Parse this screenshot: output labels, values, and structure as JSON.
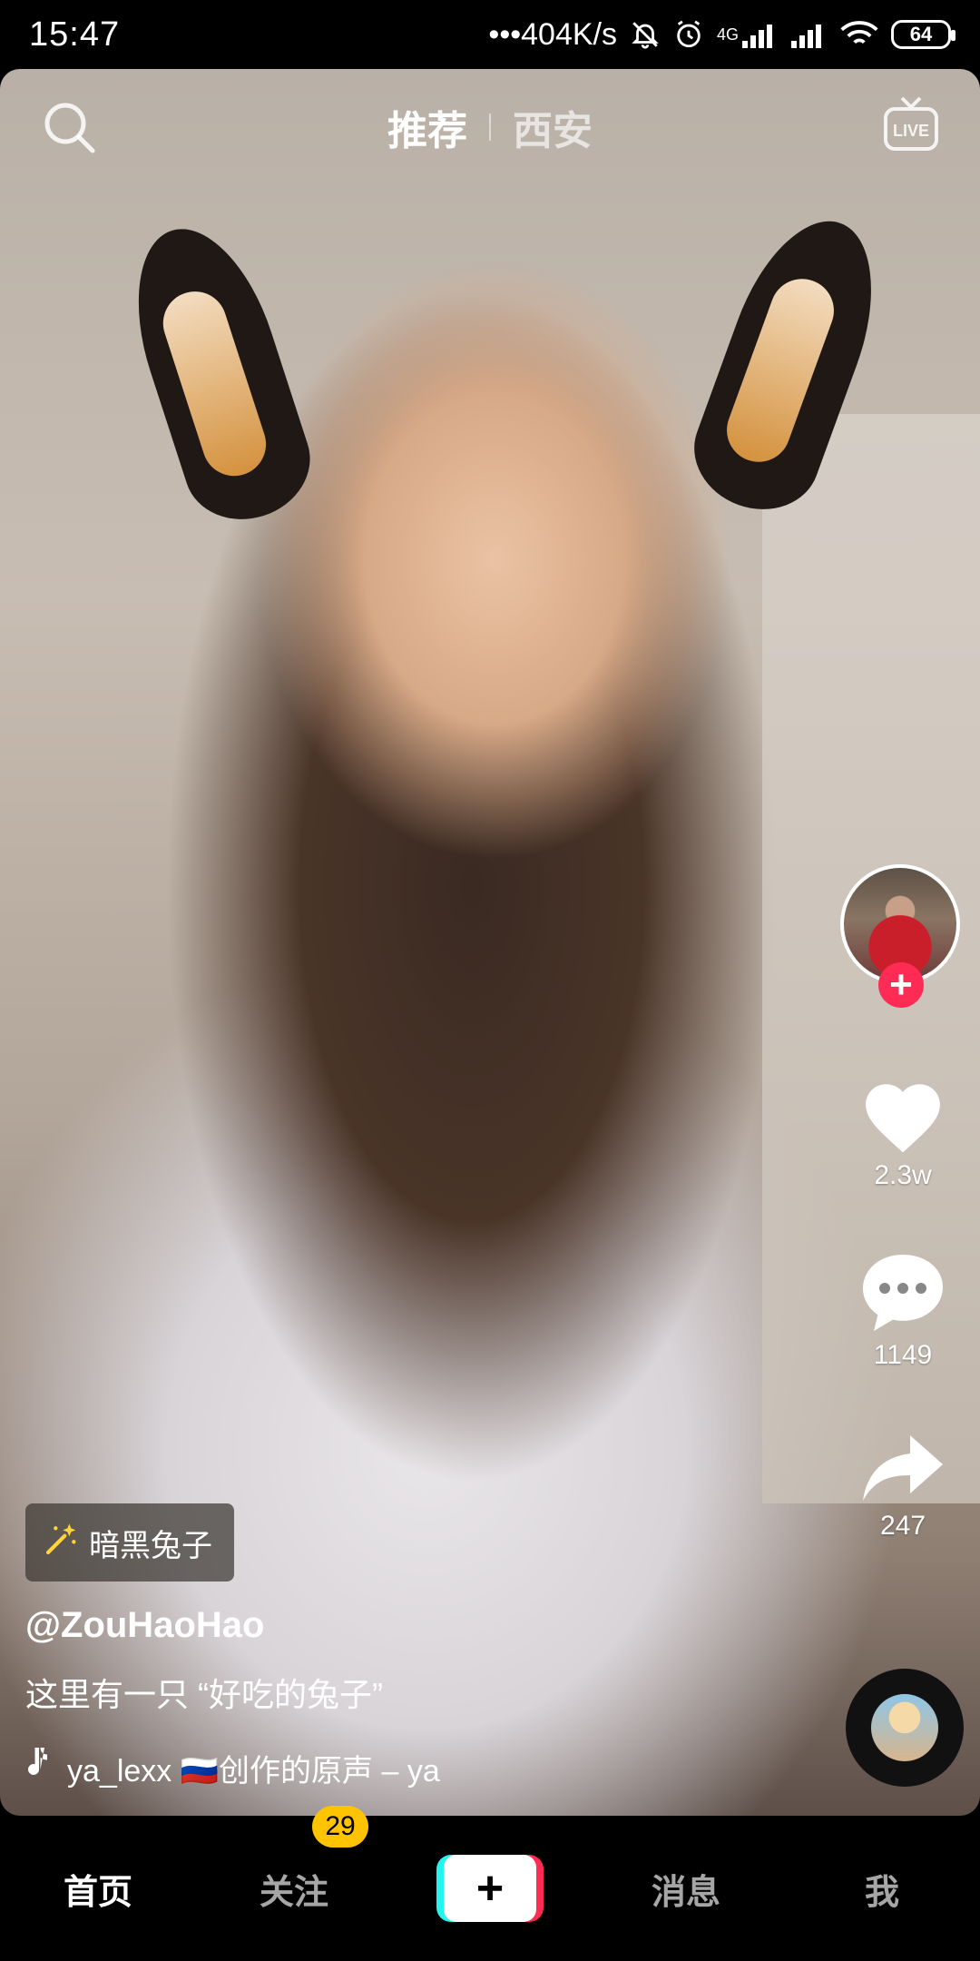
{
  "status_bar": {
    "time": "15:47",
    "network_speed": "•••404K/s",
    "network_type": "4G",
    "battery": "64"
  },
  "top_nav": {
    "tabs": [
      {
        "label": "推荐",
        "active": true
      },
      {
        "label": "西安",
        "active": false
      }
    ],
    "search_icon": "search-icon",
    "live_icon": "live-icon",
    "live_label": "LIVE"
  },
  "creator": {
    "avatar_icon": "avatar",
    "follow_label": "+"
  },
  "actions": {
    "like_count": "2.3w",
    "comment_count": "1149",
    "share_count": "247"
  },
  "info": {
    "effect_label": "暗黑兔子",
    "username": "@ZouHaoHao",
    "caption": "这里有一只 “好吃的兔子”",
    "music_text": "ya_lexx 🇷🇺创作的原声 – ya"
  },
  "bottom_tabs": {
    "home": "首页",
    "follow": "关注",
    "follow_badge": "29",
    "create": "+",
    "messages": "消息",
    "me": "我"
  },
  "colors": {
    "accent_red": "#fe2c55",
    "accent_cyan": "#25f4ee",
    "badge_yellow": "#ffc300"
  }
}
